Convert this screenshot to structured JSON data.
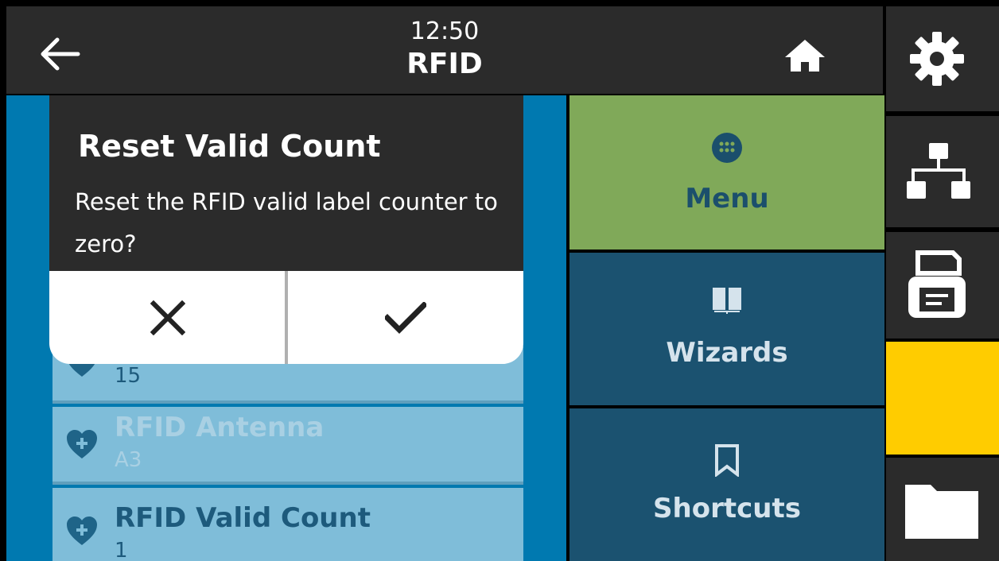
{
  "header": {
    "time": "12:50",
    "title": "RFID"
  },
  "list": {
    "items": [
      {
        "title": "",
        "value": "15"
      },
      {
        "title": "RFID Antenna",
        "value": "A3"
      },
      {
        "title": "RFID Valid Count",
        "value": "1"
      }
    ]
  },
  "dialog": {
    "title": "Reset Valid Count",
    "message": "Reset the RFID valid label counter to zero?",
    "cancel_icon": "close-icon",
    "confirm_icon": "check-icon"
  },
  "nav": {
    "menu": "Menu",
    "wizards": "Wizards",
    "shortcuts": "Shortcuts"
  },
  "sidebar": {
    "items": [
      "settings-icon",
      "network-icon",
      "printer-icon",
      "alert-status",
      "folder-icon"
    ]
  },
  "colors": {
    "header_bg": "#2b2b2b",
    "list_bg": "#0079b0",
    "list_item_bg": "#7fbdd9",
    "menu_active": "#80a959",
    "nav_bg": "#1b5270",
    "nav_text": "#d5e3ec",
    "menu_text": "#1b4f6c",
    "status_yellow": "#ffcc00"
  }
}
